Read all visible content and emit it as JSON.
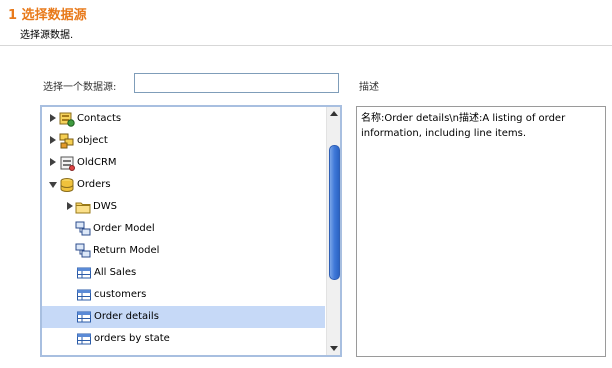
{
  "header": {
    "title": "1 选择数据源",
    "subtitle": "选择源数据."
  },
  "datasource": {
    "label": "选择一个数据源:",
    "value": "",
    "placeholder": ""
  },
  "description": {
    "label": "描述",
    "text": "名称:Order details\\n描述:A listing of order information, including line items."
  },
  "tree": {
    "items": [
      {
        "label": "Contacts",
        "icon": "datasource-icon",
        "expander": "collapsed"
      },
      {
        "label": "object",
        "icon": "object-model-icon",
        "expander": "collapsed"
      },
      {
        "label": "OldCRM",
        "icon": "database-icon",
        "expander": "collapsed"
      },
      {
        "label": "Orders",
        "icon": "database-cylinder-icon",
        "expander": "expanded"
      },
      {
        "label": "DWS",
        "icon": "folder-icon",
        "expander": "collapsed"
      },
      {
        "label": "Order Model",
        "icon": "model-icon",
        "expander": "none"
      },
      {
        "label": "Return Model",
        "icon": "model-icon",
        "expander": "none"
      },
      {
        "label": "All Sales",
        "icon": "table-icon",
        "expander": "none"
      },
      {
        "label": "customers",
        "icon": "table-icon",
        "expander": "none"
      },
      {
        "label": "Order details",
        "icon": "table-icon",
        "expander": "none",
        "selected": true
      },
      {
        "label": "orders by state",
        "icon": "table-icon",
        "expander": "none"
      }
    ]
  },
  "scrollbar": {
    "position_fraction": 0.0,
    "visible_fraction": 0.6
  }
}
